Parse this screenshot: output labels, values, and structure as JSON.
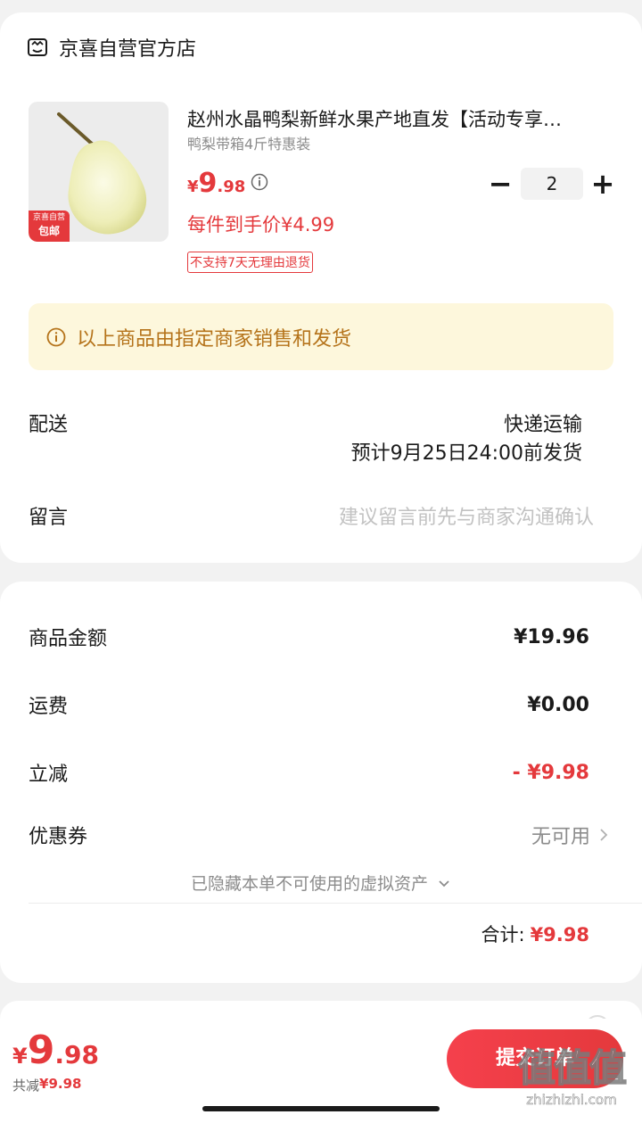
{
  "store": {
    "name": "京喜自营官方店",
    "icon": "store-icon"
  },
  "product": {
    "title": "赵州水晶鸭梨新鲜水果产地直发【活动专享…",
    "spec": "鸭梨带箱4斤特惠装",
    "badge_top": "京喜自营",
    "badge_bottom": "包邮",
    "price_symbol": "¥",
    "price_int": "9",
    "price_dec": ".98",
    "unit_price": "每件到手价¥4.99",
    "return_notice": "不支持7天无理由退货",
    "quantity": "2",
    "minus": "−",
    "plus": "+"
  },
  "notice": {
    "text": "以上商品由指定商家销售和发货",
    "icon": "info-icon"
  },
  "delivery": {
    "label": "配送",
    "method": "快递运输",
    "eta": "预计9月25日24:00前发货"
  },
  "message": {
    "label": "留言",
    "placeholder": "建议留言前先与商家沟通确认"
  },
  "summary": {
    "goods_label": "商品金额",
    "goods_value": "¥19.96",
    "freight_label": "运费",
    "freight_value": "¥0.00",
    "discount_label": "立减",
    "discount_value": "- ¥9.98",
    "coupon_label": "优惠券",
    "coupon_value": "无可用",
    "hidden_assets": "已隐藏本单不可使用的虚拟资产",
    "total_label": "合计:",
    "total_value": "¥9.98"
  },
  "footer": {
    "price_symbol": "¥",
    "price_int": "9",
    "price_dec": ".98",
    "saved_label": "共减",
    "saved_value": "¥9.98",
    "submit_label": "提交订单"
  },
  "watermark": {
    "text": "值值值",
    "url": "zhizhizhi.com"
  },
  "colors": {
    "accent": "#e4393c",
    "notice_bg": "#fdf7dc",
    "notice_text": "#b5731a"
  }
}
